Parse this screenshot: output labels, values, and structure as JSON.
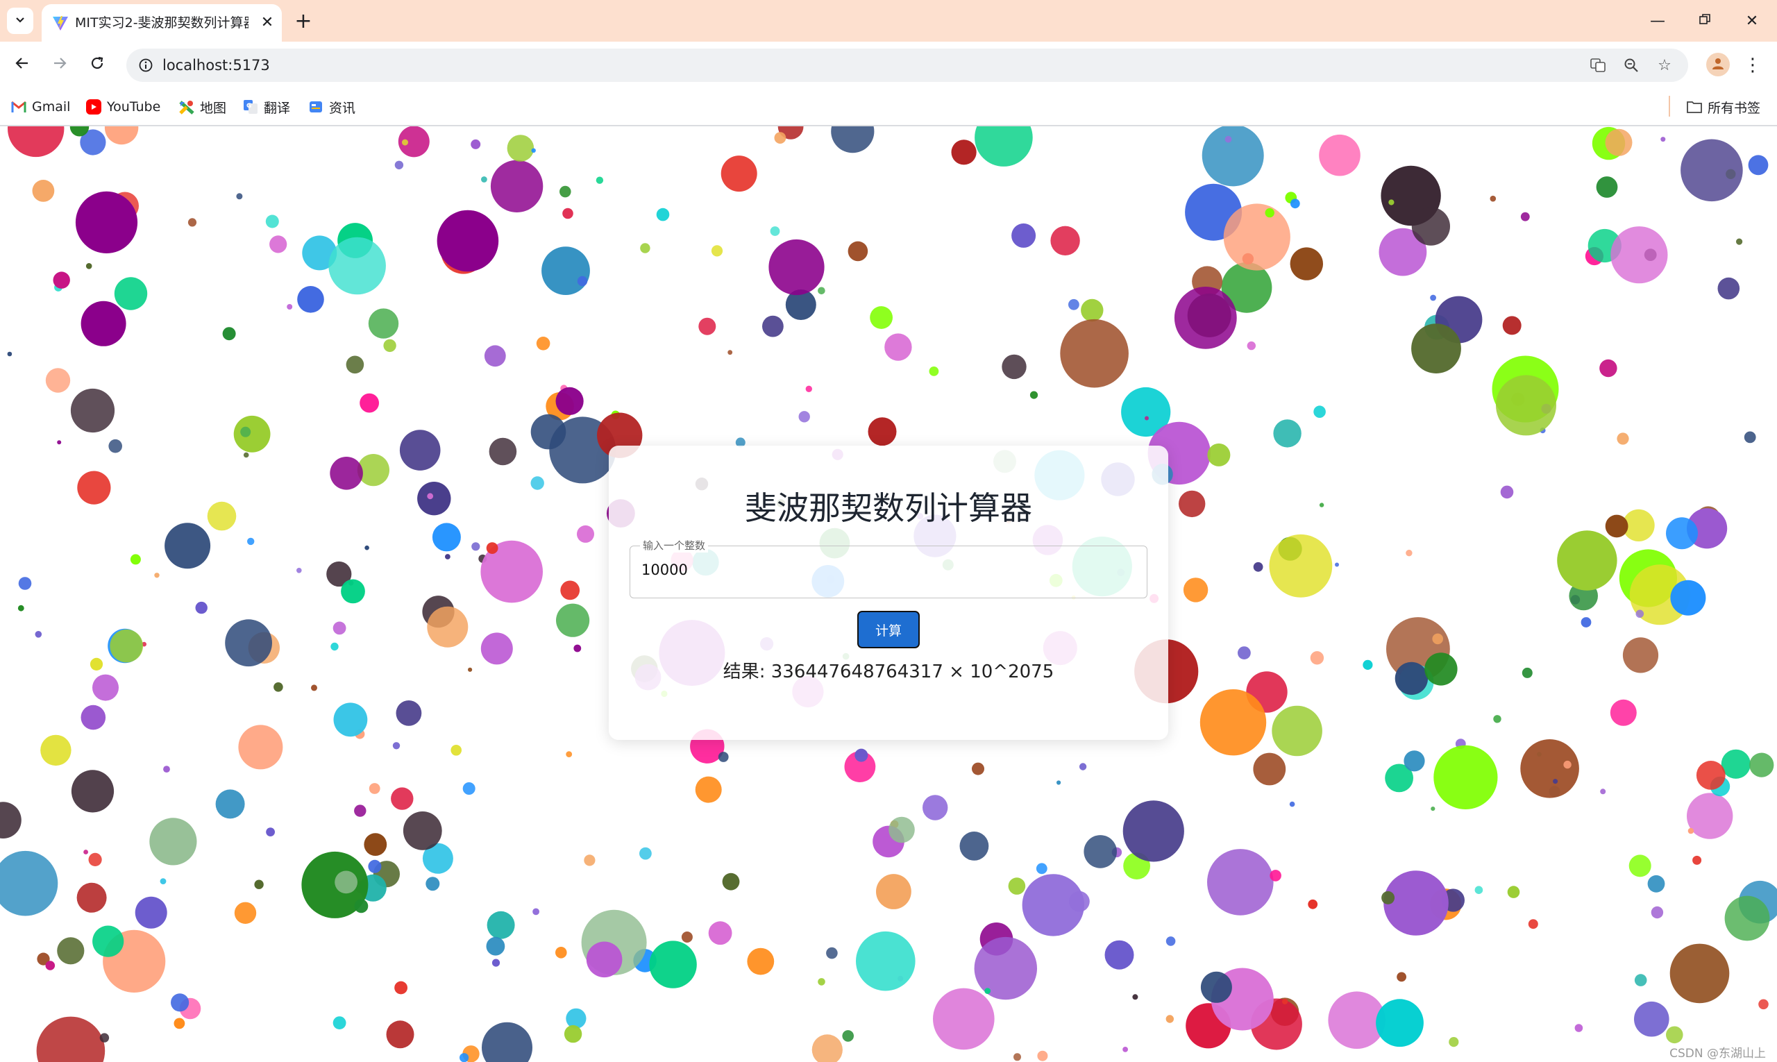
{
  "browser": {
    "tab_title": "MIT实习2-斐波那契数列计算器",
    "url": "localhost:5173",
    "bookmarks": [
      {
        "label": "Gmail",
        "icon": "gmail-icon"
      },
      {
        "label": "YouTube",
        "icon": "youtube-icon"
      },
      {
        "label": "地图",
        "icon": "maps-icon"
      },
      {
        "label": "翻译",
        "icon": "translate-icon"
      },
      {
        "label": "资讯",
        "icon": "news-icon"
      }
    ],
    "all_bookmarks_label": "所有书签"
  },
  "calculator": {
    "title": "斐波那契数列计算器",
    "input_label": "输入一个整数",
    "input_value": "10000",
    "button_label": "计算",
    "result_text": "结果: 336447648764317 × 10^2075"
  },
  "watermark": "CSDN @东湖山上",
  "colors": {
    "tab_strip": "#fde0cf",
    "button_primary": "#1e6ed1",
    "omnibox": "#eff1f3"
  }
}
